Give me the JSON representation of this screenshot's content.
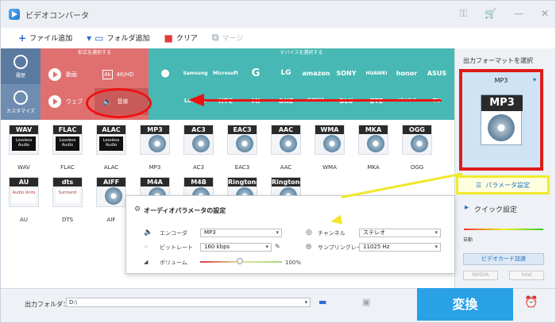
{
  "app": {
    "title": "ビデオコンバータ"
  },
  "toolbar": {
    "add_file": "ファイル追加",
    "add_folder": "フォルダ追加",
    "clear": "クリア",
    "merge": "マージ"
  },
  "sidebar": {
    "items": [
      {
        "label": "履歴"
      },
      {
        "label": "カスタマイズ"
      }
    ]
  },
  "categories": {
    "format_header": "形式を選択する",
    "device_header": "デバイスを選択する"
  },
  "format_buttons": [
    {
      "label": "動画"
    },
    {
      "label": "4K/HD"
    },
    {
      "label": "ウェブ"
    },
    {
      "label": "音楽"
    }
  ],
  "brands": [
    "Samsung",
    "Microsoft",
    "G",
    "LG",
    "amazon",
    "SONY",
    "HUAWEI",
    "honor",
    "ASUS",
    "Lenovo",
    "HTC",
    "MI",
    "ONE",
    "NOKIA",
    "BLU",
    "ZTE",
    "alcatel",
    "TV"
  ],
  "format_tiles": [
    {
      "badge": "WAV",
      "label": "WAV",
      "lossless": true
    },
    {
      "badge": "FLAC",
      "label": "FLAC",
      "lossless": true
    },
    {
      "badge": "ALAC",
      "label": "ALAC",
      "lossless": true
    },
    {
      "badge": "MP3",
      "label": "MP3"
    },
    {
      "badge": "AC3",
      "label": "AC3"
    },
    {
      "badge": "EAC3",
      "label": "EAC3"
    },
    {
      "badge": "AAC",
      "label": "AAC"
    },
    {
      "badge": "WMA",
      "label": "WMA"
    },
    {
      "badge": "MKA",
      "label": "MKA"
    },
    {
      "badge": "OGG",
      "label": "OGG"
    },
    {
      "badge": "AU",
      "label": "AU",
      "sub": "Audio Units"
    },
    {
      "badge": "dts",
      "label": "DTS",
      "sub": "Surround"
    },
    {
      "badge": "AIFF",
      "label": "AIF"
    },
    {
      "badge": "M4A",
      "label": ""
    },
    {
      "badge": "M4B",
      "label": ""
    },
    {
      "badge": "Ringtone",
      "label": ""
    },
    {
      "badge": "Ringtone",
      "label": ""
    }
  ],
  "lossless_text": "Lossless Audio",
  "audio_params": {
    "title": "オーディオパラメータの設定",
    "encoder_label": "エンコーダ",
    "encoder_value": "MP3",
    "bitrate_label": "ビットレート",
    "bitrate_value": "160 kbps",
    "volume_label": "ボリューム",
    "volume_value": "100%",
    "volume_level": 0.5,
    "channel_label": "チャンネル",
    "channel_value": "ステレオ",
    "samplerate_label": "サンプリングレート",
    "samplerate_value": "11025 Hz"
  },
  "output": {
    "label": "出力フォーマットを選択",
    "format": "MP3",
    "param_button": "パラメータ設定",
    "quick_label": "クイック設定",
    "speed_auto": "自動",
    "accel_button": "ビデオカード加速",
    "chips": [
      "NVIDIA",
      "Intel"
    ]
  },
  "footer": {
    "folder_label": "出力フォルダ：",
    "folder_value": "D:\\",
    "convert_button": "変換"
  },
  "colors": {
    "format_bg": "#e07070",
    "device_bg": "#47b8b3",
    "accent": "#2aa0e6",
    "highlight_red": "#dd1c1c",
    "highlight_yellow": "#f0ea2a"
  }
}
